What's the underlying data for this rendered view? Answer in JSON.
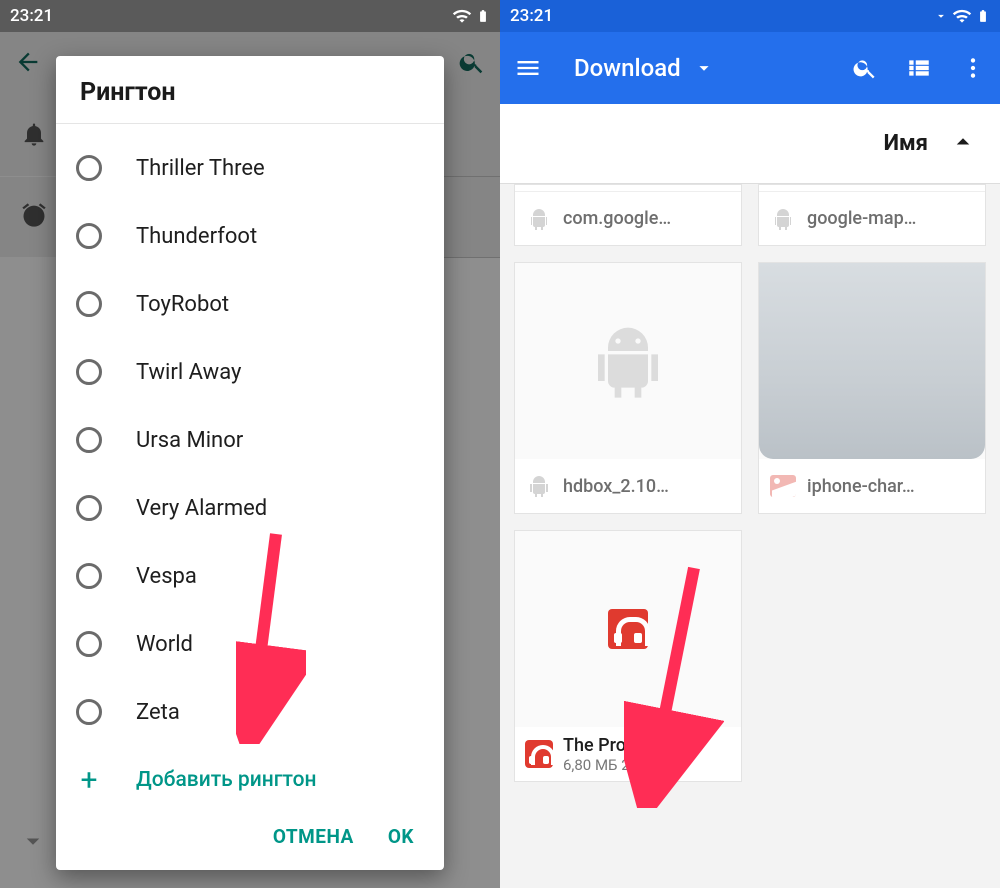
{
  "status_time": "23:21",
  "left": {
    "dialog_title": "Рингтон",
    "ringtones": [
      "Thriller Three",
      "Thunderfoot",
      "ToyRobot",
      "Twirl Away",
      "Ursa Minor",
      "Very Alarmed",
      "Vespa",
      "World",
      "Zeta"
    ],
    "add_label": "Добавить рингтон",
    "cancel": "ОТМЕНА",
    "ok": "OK"
  },
  "right": {
    "appbar_title": "Download",
    "sort_label": "Имя",
    "files": {
      "top1": "com.google…",
      "top2": "google-map…",
      "mid1": "hdbox_2.10…",
      "mid2": "iphone-char…",
      "bottom_name": "The Prodigy…",
      "bottom_meta": "6,80 МБ 23:02"
    }
  }
}
